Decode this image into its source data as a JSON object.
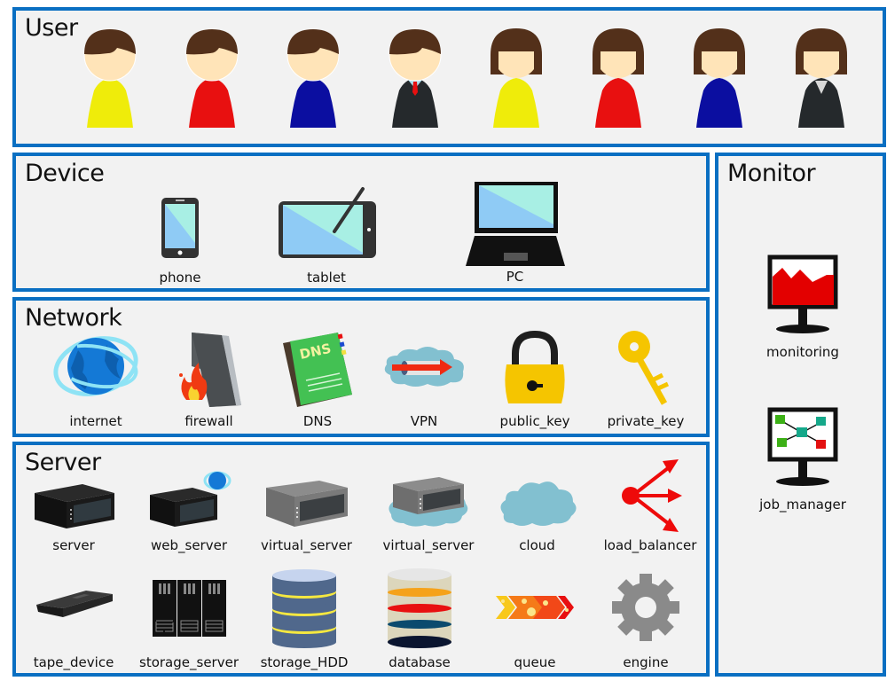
{
  "colors": {
    "border": "#0a6fc2",
    "panel_bg": "#f2f2f2",
    "hair": "#53301a",
    "skin": "#ffe4b8",
    "shirt_yellow": "#efec0a",
    "shirt_red": "#e81010",
    "shirt_blue": "#0b0ea0",
    "suit": "#25292c"
  },
  "panels": {
    "user": {
      "title": "User",
      "people": [
        {
          "type": "male",
          "outfit": "yellow"
        },
        {
          "type": "male",
          "outfit": "red"
        },
        {
          "type": "male",
          "outfit": "blue"
        },
        {
          "type": "male",
          "outfit": "suit"
        },
        {
          "type": "female",
          "outfit": "yellow"
        },
        {
          "type": "female",
          "outfit": "red"
        },
        {
          "type": "female",
          "outfit": "blue"
        },
        {
          "type": "female",
          "outfit": "suit"
        }
      ]
    },
    "device": {
      "title": "Device",
      "items": [
        {
          "label": "phone",
          "icon": "phone-icon"
        },
        {
          "label": "tablet",
          "icon": "tablet-icon"
        },
        {
          "label": "PC",
          "icon": "laptop-icon"
        }
      ]
    },
    "network": {
      "title": "Network",
      "items": [
        {
          "label": "internet",
          "icon": "globe-icon"
        },
        {
          "label": "firewall",
          "icon": "firewall-icon"
        },
        {
          "label": "DNS",
          "icon": "dns-book-icon",
          "badge": "DNS"
        },
        {
          "label": "VPN",
          "icon": "vpn-tunnel-icon"
        },
        {
          "label": "public_key",
          "icon": "padlock-icon"
        },
        {
          "label": "private_key",
          "icon": "key-icon"
        }
      ]
    },
    "server": {
      "title": "Server",
      "items": [
        {
          "label": "server",
          "icon": "server-icon"
        },
        {
          "label": "web_server",
          "icon": "web-server-icon"
        },
        {
          "label": "virtual_server",
          "icon": "virtual-server-icon"
        },
        {
          "label": "virtual_server",
          "icon": "cloud-virtual-server-icon"
        },
        {
          "label": "cloud",
          "icon": "cloud-icon"
        },
        {
          "label": "load_balancer",
          "icon": "load-balancer-icon"
        },
        {
          "label": "tape_device",
          "icon": "tape-device-icon"
        },
        {
          "label": "storage_server",
          "icon": "storage-server-icon"
        },
        {
          "label": "storage_HDD",
          "icon": "hdd-stack-icon"
        },
        {
          "label": "database",
          "icon": "database-icon"
        },
        {
          "label": "queue",
          "icon": "queue-icon"
        },
        {
          "label": "engine",
          "icon": "gear-icon"
        }
      ]
    },
    "monitor": {
      "title": "Monitor",
      "items": [
        {
          "label": "monitoring",
          "icon": "monitoring-screen-icon"
        },
        {
          "label": "job_manager",
          "icon": "job-manager-screen-icon"
        }
      ]
    }
  }
}
